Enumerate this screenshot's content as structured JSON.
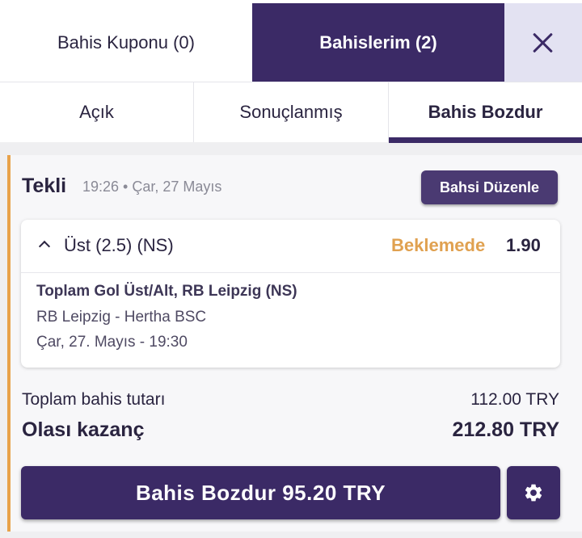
{
  "top_tabs": {
    "coupon_label": "Bahis Kuponu (0)",
    "my_bets_label": "Bahislerim (2)"
  },
  "sub_tabs": {
    "open_label": "Açık",
    "settled_label": "Sonuçlanmış",
    "cashout_label": "Bahis Bozdur",
    "active": "Bahis Bozdur"
  },
  "bet": {
    "type": "Tekli",
    "placed_at": "19:26 • Çar, 27 Mayıs",
    "edit_label": "Bahsi Düzenle",
    "selection": {
      "name": "Üst (2.5) (NS)",
      "status": "Beklemede",
      "odds": "1.90",
      "market": "Toplam Gol Üst/Alt, RB Leipzig (NS)",
      "match": "RB Leipzig - Hertha BSC",
      "datetime": "Çar, 27. Mayıs - 19:30"
    },
    "stake_label": "Toplam bahis tutarı",
    "stake_value": "112.00 TRY",
    "potential_win_label": "Olası kazanç",
    "potential_win_value": "212.80 TRY",
    "cashout_button_label": "Bahis Bozdur 95.20 TRY"
  },
  "icons": {
    "close": "close-icon",
    "chevron": "chevron-up-icon",
    "settings": "gear-icon"
  },
  "colors": {
    "brand": "#3b2a66",
    "pending": "#e0a150",
    "accent_border": "#e8a24a"
  }
}
